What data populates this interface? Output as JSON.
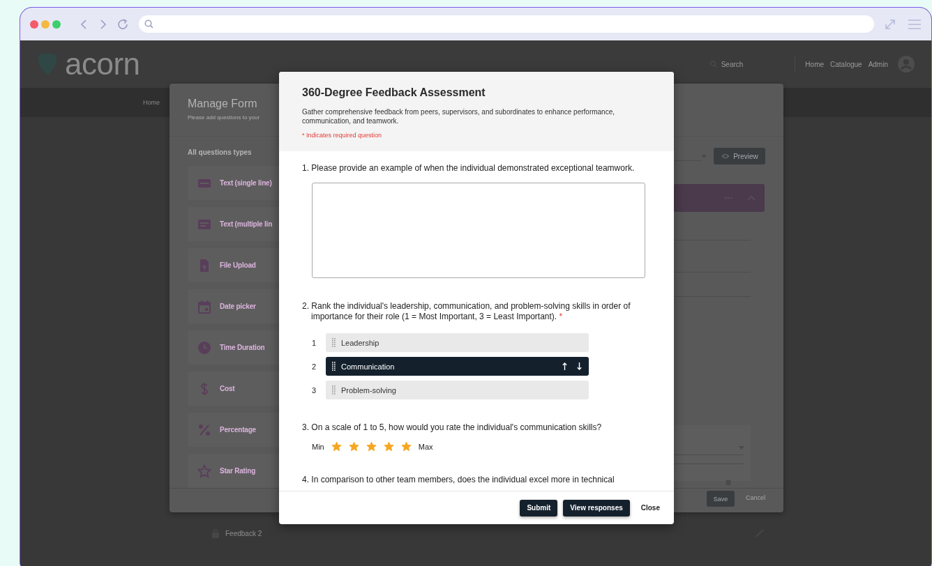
{
  "app": {
    "logo": "acorn",
    "search": "Search",
    "nav": [
      "Home",
      "Catalogue",
      "Admin"
    ],
    "breadcrumb": "Home"
  },
  "manage_form": {
    "title": "Manage Form",
    "subtitle": "Please add questions to your",
    "section_title": "All questions types",
    "question_types": [
      {
        "kind": "text_single",
        "label": "Text (single line)"
      },
      {
        "kind": "text_multi",
        "label": "Text (multiple lin"
      },
      {
        "kind": "file",
        "label": "File Upload"
      },
      {
        "kind": "date",
        "label": "Date picker"
      },
      {
        "kind": "time",
        "label": "Time Duration"
      },
      {
        "kind": "cost",
        "label": "Cost"
      },
      {
        "kind": "percent",
        "label": "Percentage"
      },
      {
        "kind": "star",
        "label": "Star Rating"
      }
    ],
    "preview_button": "Preview",
    "save_button": "Save",
    "cancel_button": "Cancel"
  },
  "form_list": [
    {
      "title": "Feedback 2"
    }
  ],
  "modal": {
    "title": "360-Degree Feedback Assessment",
    "description": "Gather comprehensive feedback from peers, supervisors, and subordinates to enhance performance, communication, and teamwork.",
    "required_note": "* Indicates required question",
    "questions": [
      {
        "kind": "long_text",
        "text": "1. Please provide an example of when the individual demonstrated exceptional teamwork."
      },
      {
        "kind": "ranking",
        "text": "2. Rank the individual's leadership, communication, and problem-solving skills in order of importance for their role (1 = Most Important, 3 = Least Important).",
        "required_mark": "*",
        "items": [
          {
            "rank": "1",
            "label": "Leadership",
            "selected": false
          },
          {
            "rank": "2",
            "label": "Communication",
            "selected": true
          },
          {
            "rank": "3",
            "label": "Problem-solving",
            "selected": false
          }
        ]
      },
      {
        "kind": "rating",
        "text": "3. On a scale of 1 to 5, how would you rate the individual's communication skills?",
        "min_label": "Min",
        "max_label": "Max",
        "stars": 5
      },
      {
        "kind": "partial",
        "text": "4. In comparison to other team members, does the individual excel more in technical"
      }
    ],
    "buttons": [
      {
        "kind": "primary",
        "label": "Submit"
      },
      {
        "kind": "primary",
        "label": "View responses"
      },
      {
        "kind": "plain",
        "label": "Close"
      }
    ]
  }
}
